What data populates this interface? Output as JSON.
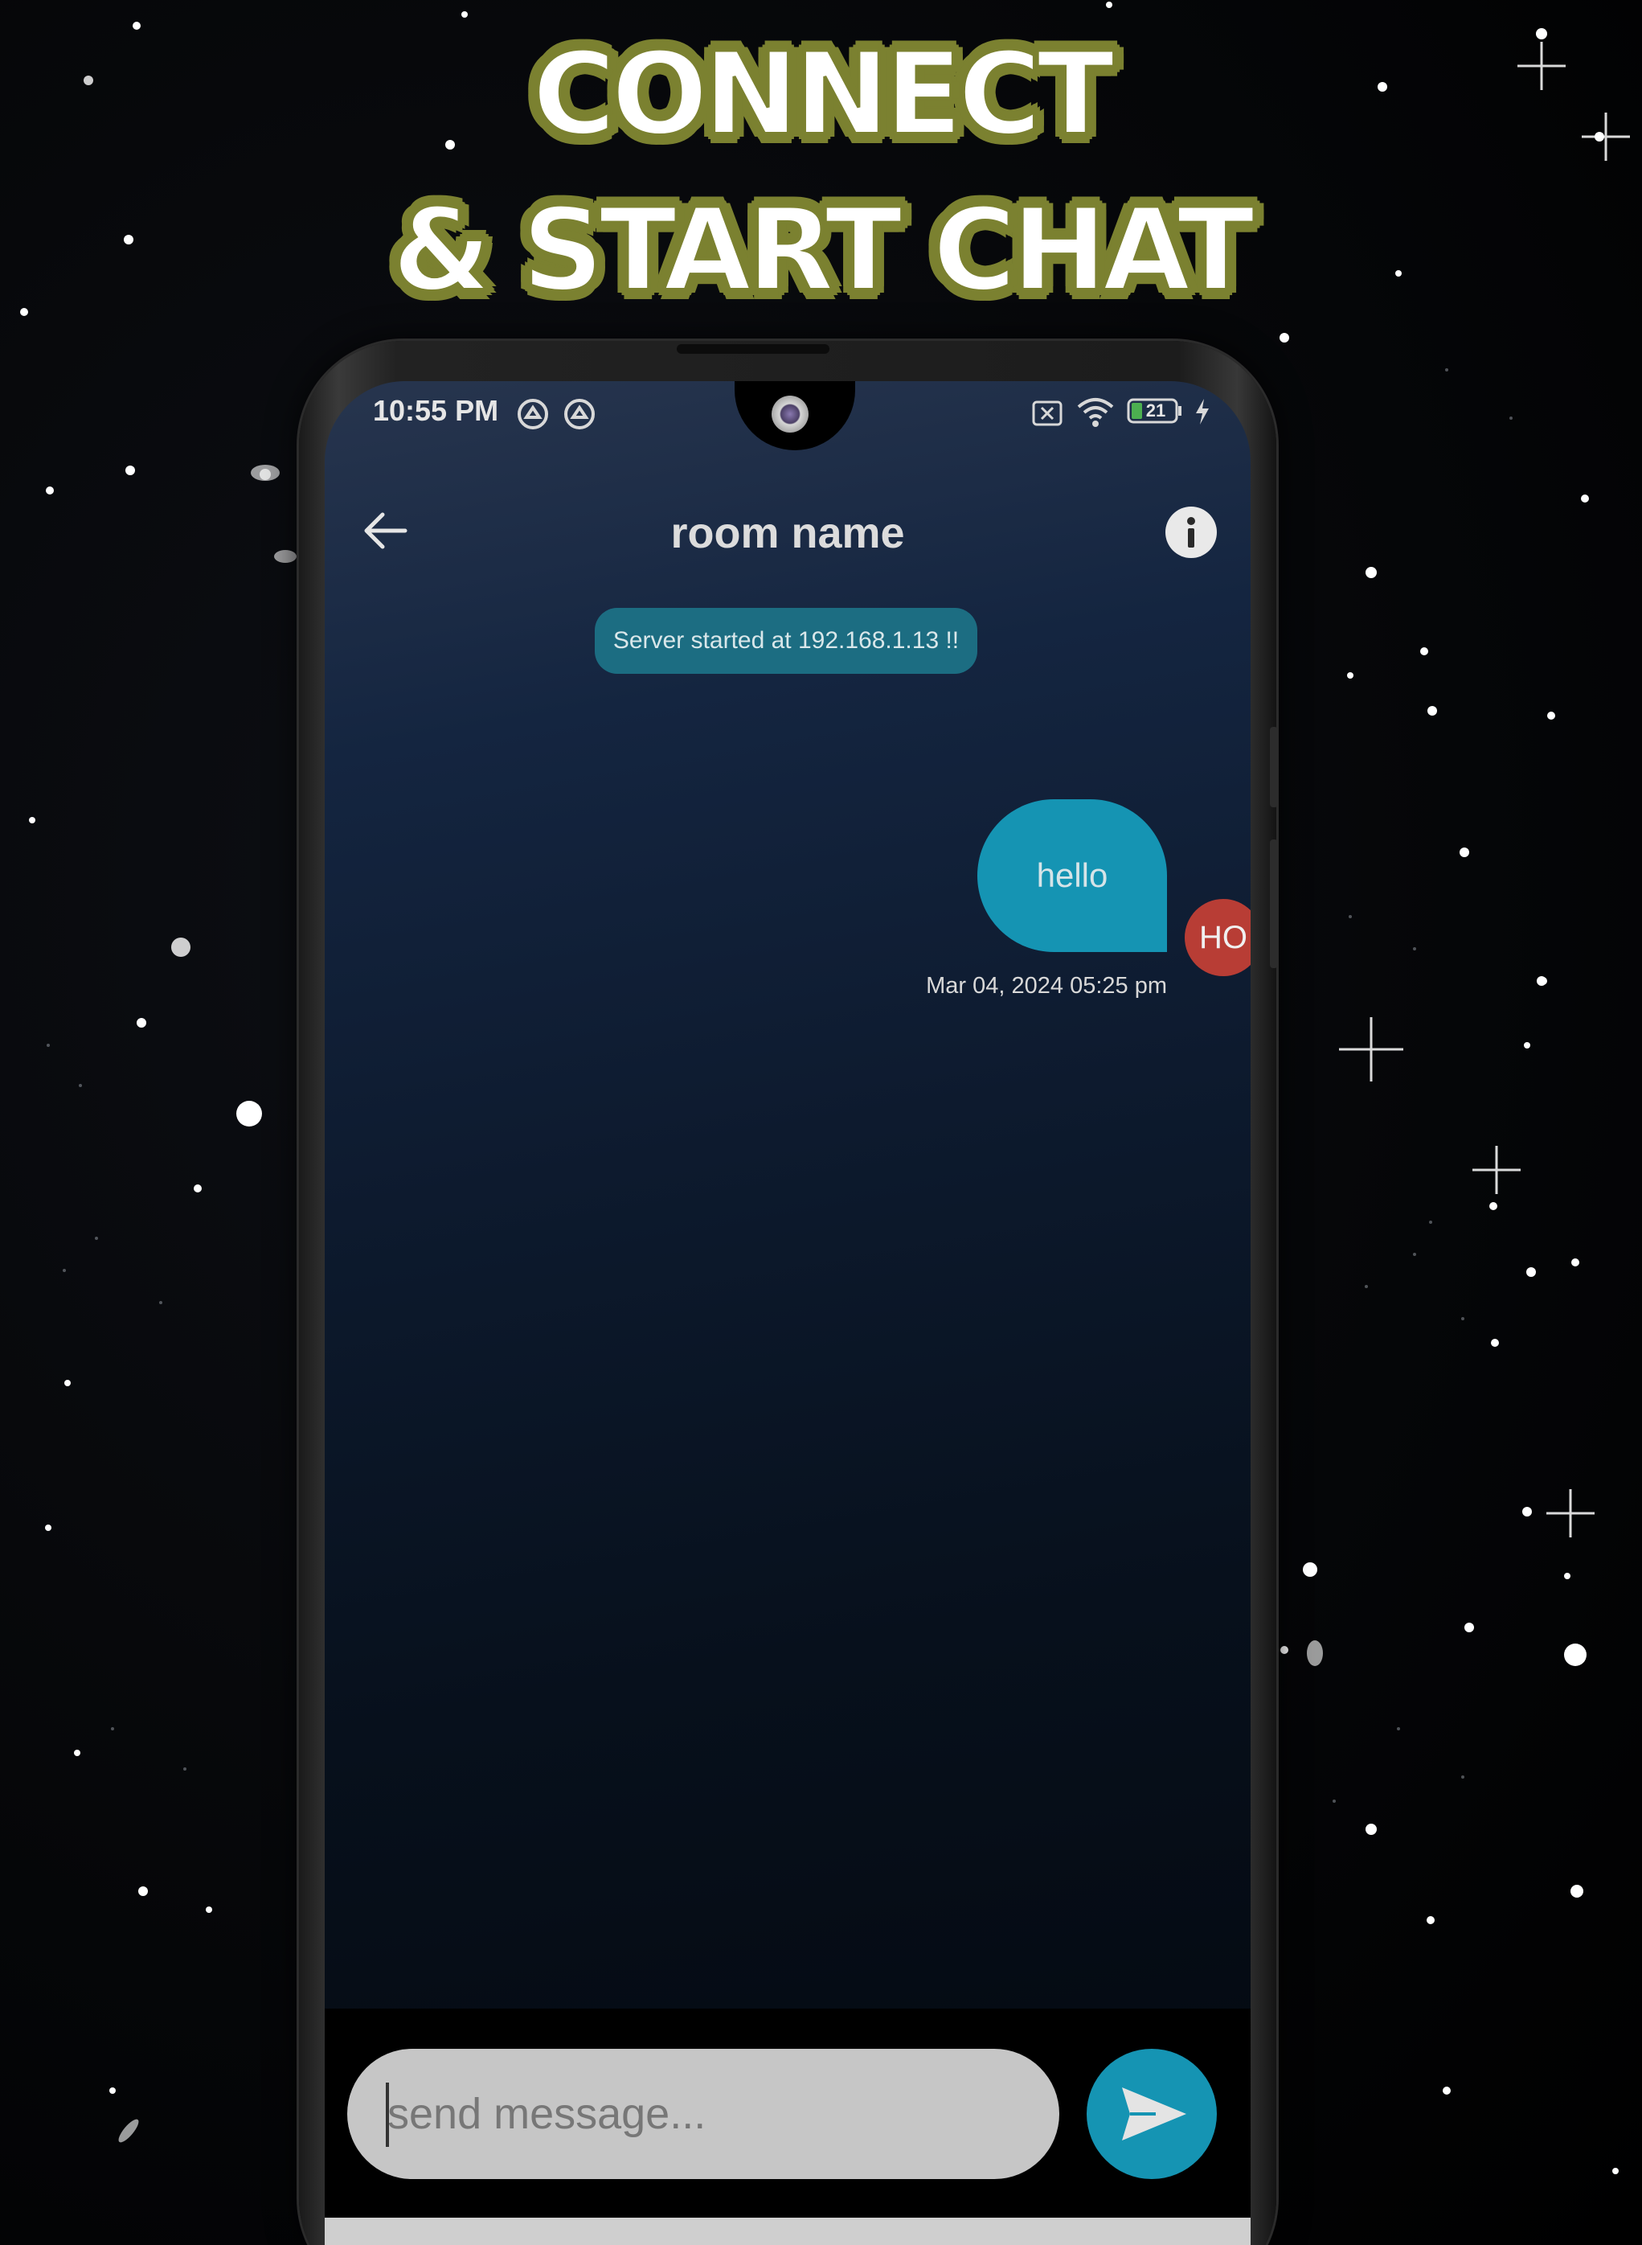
{
  "promo": {
    "line1": "CONNECT",
    "line2": "& START CHAT"
  },
  "status_bar": {
    "time": "10:55 PM",
    "battery": "21",
    "icons": [
      "sync-icon",
      "sync-icon",
      "sim-off-icon",
      "wifi-icon",
      "battery-icon",
      "charging-icon"
    ]
  },
  "app_bar": {
    "title": "room name",
    "back_icon": "arrow-left-icon",
    "info_icon": "info-icon"
  },
  "chat": {
    "system_message": "Server started at 192.168.1.13 !!",
    "messages": [
      {
        "text": "hello",
        "sender_initials": "HO",
        "timestamp": "Mar 04, 2024 05:25 pm",
        "own": true
      }
    ]
  },
  "composer": {
    "placeholder": "send message...",
    "send_icon": "send-icon"
  },
  "colors": {
    "accent": "#1594b3",
    "system_bubble": "#1c6d82",
    "avatar": "#b83d35",
    "headline_outline": "#7b8130"
  }
}
